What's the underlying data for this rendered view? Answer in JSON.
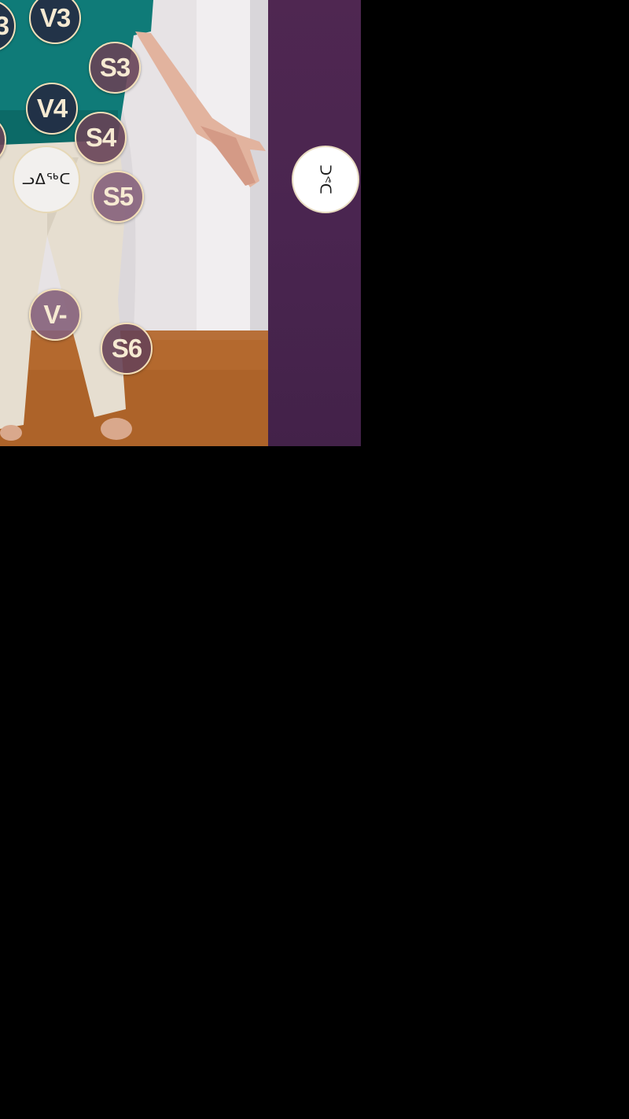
{
  "badges": {
    "partial_left_top": "3",
    "v3": "V3",
    "s3": "S3",
    "v4": "V4",
    "s4": "S4",
    "s5": "S5",
    "v_minus": "V-",
    "s6": "S6"
  },
  "glyph_buttons": {
    "body_glyph": "ᓗᐃᖅᑕ",
    "side_glyph": "ᑐᕝᑕ"
  },
  "colors": {
    "sidebar": "#4b2650",
    "badge_border": "#f3dfb8",
    "badge_dark": "#242c44",
    "badge_mauve": "#85607a"
  }
}
